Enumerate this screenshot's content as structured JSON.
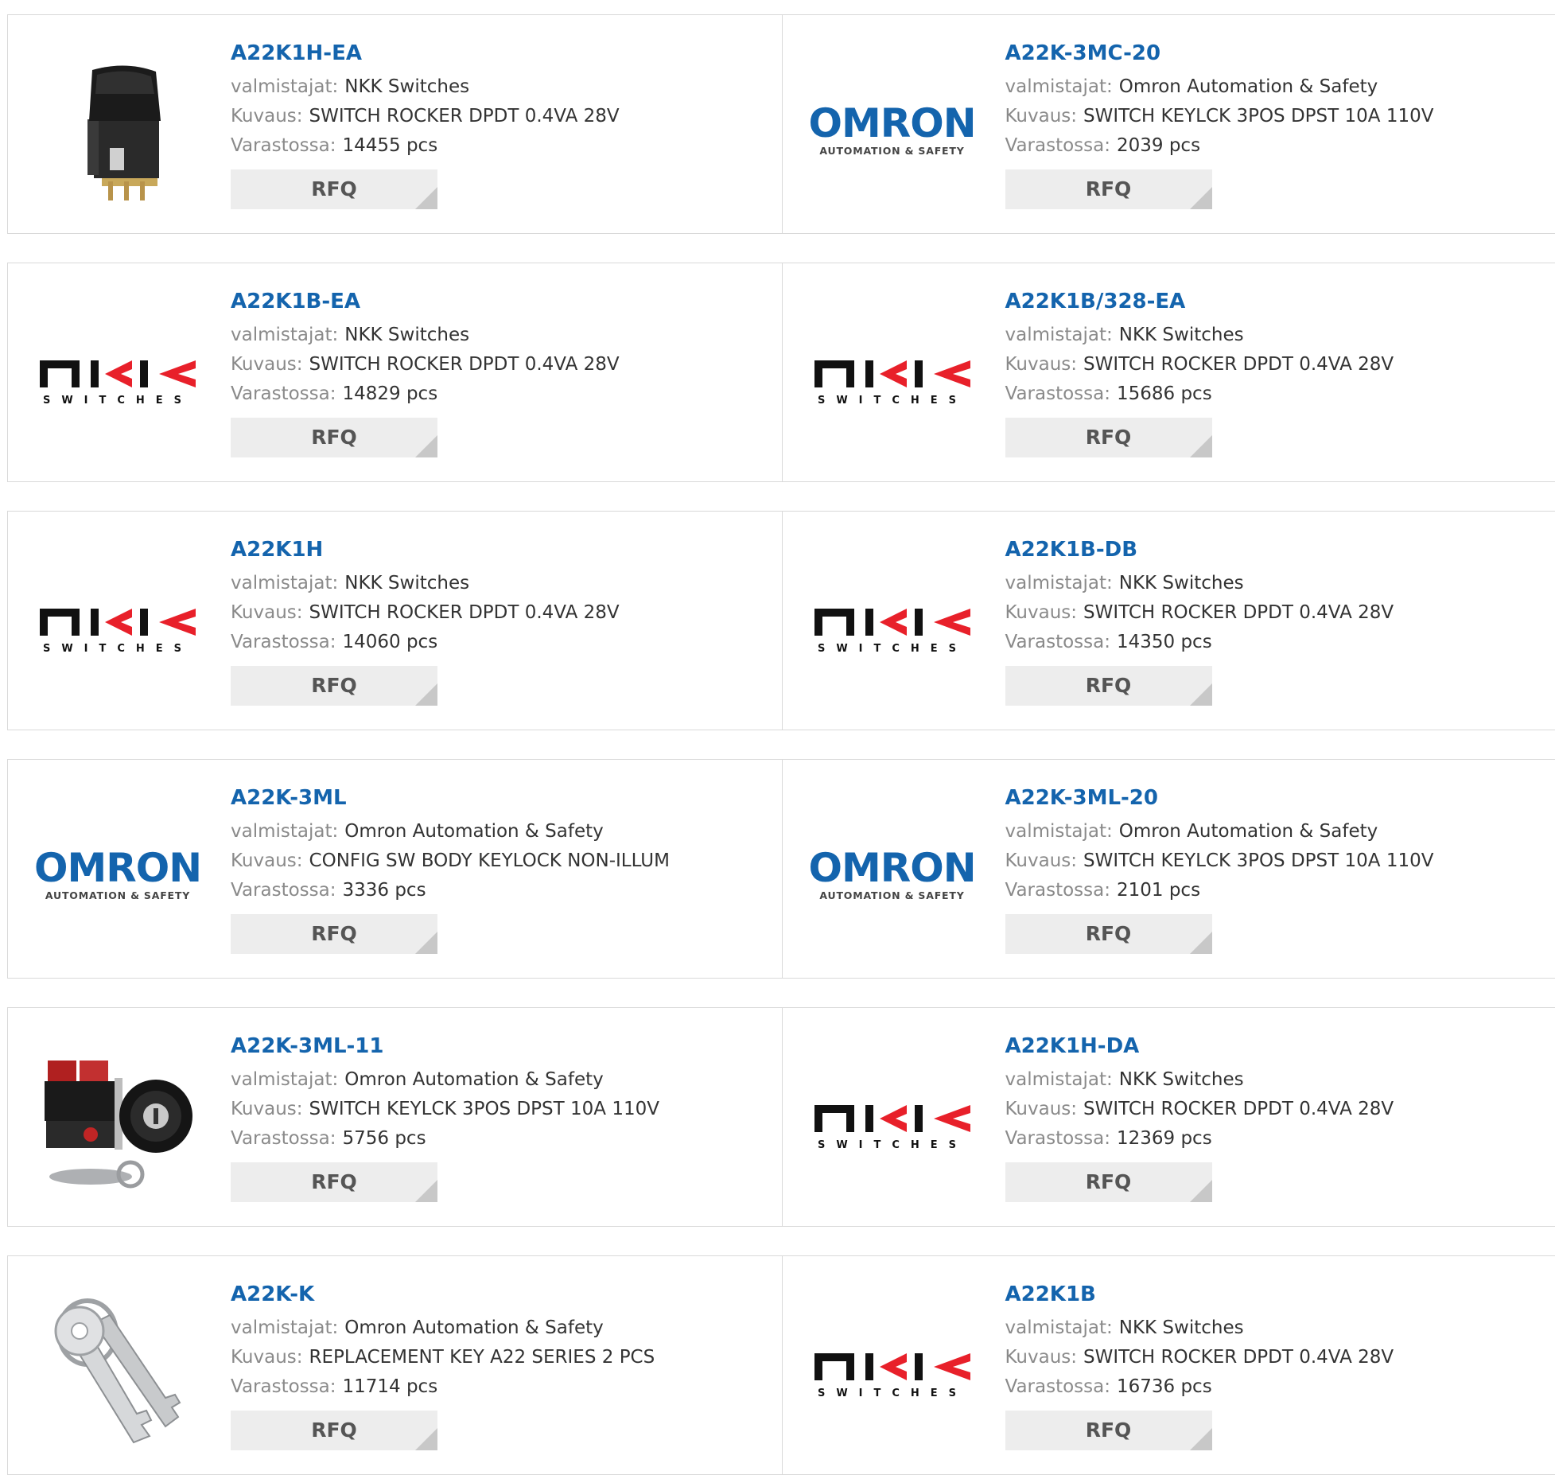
{
  "labels": {
    "manufacturer": "valmistajat:",
    "description": "Kuvaus:",
    "stock": "Varastossa:",
    "rfq": "RFQ"
  },
  "logos": {
    "omron_word": "OMRON",
    "omron_sub": "AUTOMATION & SAFETY",
    "nkk_word": "NKK",
    "nkk_sub": "SWITCHES"
  },
  "colors": {
    "part_link": "#1464ad",
    "nkk_red": "#e8202a",
    "omron_blue": "#1464ad"
  },
  "products": [
    {
      "pn": "A22K1H-EA",
      "mfr": "NKK Switches",
      "desc": "SWITCH ROCKER DPDT 0.4VA 28V",
      "stock": "14455 pcs",
      "image": "rocker-switch-photo"
    },
    {
      "pn": "A22K-3MC-20",
      "mfr": "Omron Automation & Safety",
      "desc": "SWITCH KEYLCK 3POS DPST 10A 110V",
      "stock": "2039 pcs",
      "image": "omron-logo"
    },
    {
      "pn": "A22K1B-EA",
      "mfr": "NKK Switches",
      "desc": "SWITCH ROCKER DPDT 0.4VA 28V",
      "stock": "14829 pcs",
      "image": "nkk-logo"
    },
    {
      "pn": "A22K1B/328-EA",
      "mfr": "NKK Switches",
      "desc": "SWITCH ROCKER DPDT 0.4VA 28V",
      "stock": "15686 pcs",
      "image": "nkk-logo"
    },
    {
      "pn": "A22K1H",
      "mfr": "NKK Switches",
      "desc": "SWITCH ROCKER DPDT 0.4VA 28V",
      "stock": "14060 pcs",
      "image": "nkk-logo"
    },
    {
      "pn": "A22K1B-DB",
      "mfr": "NKK Switches",
      "desc": "SWITCH ROCKER DPDT 0.4VA 28V",
      "stock": "14350 pcs",
      "image": "nkk-logo"
    },
    {
      "pn": "A22K-3ML",
      "mfr": "Omron Automation & Safety",
      "desc": "CONFIG SW BODY KEYLOCK NON-ILLUM",
      "stock": "3336 pcs",
      "image": "omron-logo"
    },
    {
      "pn": "A22K-3ML-20",
      "mfr": "Omron Automation & Safety",
      "desc": "SWITCH KEYLCK 3POS DPST 10A 110V",
      "stock": "2101 pcs",
      "image": "omron-logo"
    },
    {
      "pn": "A22K-3ML-11",
      "mfr": "Omron Automation & Safety",
      "desc": "SWITCH KEYLCK 3POS DPST 10A 110V",
      "stock": "5756 pcs",
      "image": "keylock-switch-photo"
    },
    {
      "pn": "A22K1H-DA",
      "mfr": "NKK Switches",
      "desc": "SWITCH ROCKER DPDT 0.4VA 28V",
      "stock": "12369 pcs",
      "image": "nkk-logo"
    },
    {
      "pn": "A22K-K",
      "mfr": "Omron Automation & Safety",
      "desc": "REPLACEMENT KEY A22 SERIES 2 PCS",
      "stock": "11714 pcs",
      "image": "keys-photo"
    },
    {
      "pn": "A22K1B",
      "mfr": "NKK Switches",
      "desc": "SWITCH ROCKER DPDT 0.4VA 28V",
      "stock": "16736 pcs",
      "image": "nkk-logo"
    }
  ]
}
